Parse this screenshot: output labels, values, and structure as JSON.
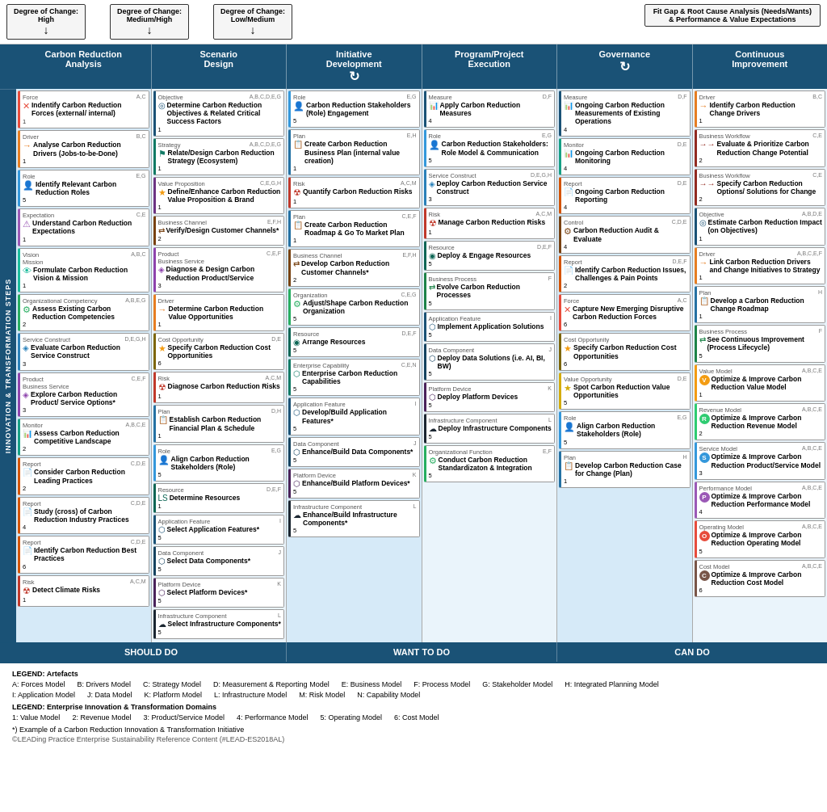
{
  "topArrows": [
    {
      "label": "Degree of Change:\nHigh"
    },
    {
      "label": "Degree of Change:\nMedium/High"
    },
    {
      "label": "Degree of Change:\nLow/Medium"
    }
  ],
  "topRight": {
    "label": "Fit Gap & Root Cause Analysis (Needs/Wants)\n& Performance & Value Expectations"
  },
  "colHeaders": [
    {
      "label": "Carbon Reduction\nAnalysis"
    },
    {
      "label": "Scenario\nDesign"
    },
    {
      "label": "Initiative\nDevelopment"
    },
    {
      "label": "Program/Project\nExecution"
    },
    {
      "label": "Governance"
    },
    {
      "label": "Continuous\nImprovement"
    }
  ],
  "sideLabel": "INNOVATION & TRANSFORMATION STEPS",
  "columns": {
    "col1": [
      {
        "type": "Force",
        "codes": "A,C",
        "title": "Indentify Carbon Reduction Forces (external/ internal)",
        "num": "1",
        "icon": "x"
      },
      {
        "type": "Driver",
        "codes": "B,C",
        "title": "Analyse Carbon Reduction Drivers (Jobs-to-be-Done)",
        "num": "1",
        "icon": "arrow"
      },
      {
        "type": "Role",
        "codes": "E,G",
        "title": "Identify Relevant Carbon Reduction Roles",
        "num": "5",
        "icon": "person"
      },
      {
        "type": "Expectation",
        "codes": "C,E",
        "title": "Understand Carbon Reduction Expectations",
        "num": "1",
        "icon": "exclaim"
      },
      {
        "type": "Vision\nMission",
        "codes": "A,B,C",
        "title": "Formulate Carbon Reduction Vision & Mission",
        "num": "1",
        "icon": "eye"
      },
      {
        "type": "Organizational Competency",
        "codes": "A,B,E,G",
        "title": "Assess Existing Carbon Reduction Competencies",
        "num": "2",
        "icon": "gear"
      },
      {
        "type": "Service Construct",
        "codes": "D,E,G,H",
        "title": "Evaluate Carbon Reduction Service Construct",
        "num": "3",
        "icon": "box"
      },
      {
        "type": "Product\nBusiness Service",
        "codes": "C,E,F",
        "title": "Explore Carbon Reduction Product/ Service Options*",
        "num": "3",
        "icon": "box"
      },
      {
        "type": "Monitor",
        "codes": "A,B,C,E",
        "title": "Assess Carbon Reduction Competitive Landscape",
        "num": "2",
        "icon": "chart"
      },
      {
        "type": "Report",
        "codes": "C,D,E",
        "title": "Consider Carbon Reduction Leading Practices",
        "num": "2",
        "icon": "doc"
      },
      {
        "type": "Report",
        "codes": "C,D,E",
        "title": "Study (cross) of Carbon Reduction Industry Practices",
        "num": "4",
        "icon": "doc"
      },
      {
        "type": "Report",
        "codes": "C,D,E",
        "title": "Identify Carbon Reduction Best Practices",
        "num": "6",
        "icon": "doc"
      },
      {
        "type": "Risk",
        "codes": "A,C,M",
        "title": "Detect Climate Risks",
        "num": "1",
        "icon": "lightning"
      }
    ],
    "col2": [
      {
        "type": "Objective",
        "codes": "A,B,C,D,E,G",
        "title": "Determine Carbon Reduction Objectives & Related Critical Success Factors",
        "num": "1",
        "icon": "target"
      },
      {
        "type": "Strategy",
        "codes": "A,B,C,D,E,G",
        "title": "Relate/Design Carbon Reduction Strategy (Ecosystem)",
        "num": "1",
        "icon": "flag"
      },
      {
        "type": "Value Proposition",
        "codes": "C,E,G,H",
        "title": "Define/Enhance Carbon Reduction Value Proposition & Brand",
        "num": "1",
        "icon": "star"
      },
      {
        "type": "Business Channel",
        "codes": "E,F,H",
        "title": "Verify/Design Customer Channels*",
        "num": "2",
        "icon": "flow"
      },
      {
        "type": "Product\nBusiness Service",
        "codes": "C,E,F",
        "title": "Diagnose & Design Carbon Reduction Product/Service",
        "num": "3",
        "icon": "box"
      },
      {
        "type": "Driver",
        "codes": "",
        "title": "Determine Carbon Reduction Value Opportunities",
        "num": "1",
        "icon": "arrow"
      },
      {
        "type": "Cost Opportunity",
        "codes": "D,E",
        "title": "Specify Carbon Reduction Cost Opportunities",
        "num": "6",
        "icon": "star"
      },
      {
        "type": "Risk",
        "codes": "A,C,M",
        "title": "Diagnose Carbon Reduction Risks",
        "num": "1",
        "icon": "lightning"
      },
      {
        "type": "Plan",
        "codes": "D,H",
        "title": "Establish Carbon Reduction Financial Plan & Schedule",
        "num": "1",
        "icon": "doc"
      },
      {
        "type": "Role",
        "codes": "E,G",
        "title": "Align Carbon Reduction Stakeholders (Role)",
        "num": "5",
        "icon": "person"
      },
      {
        "type": "Resource",
        "codes": "D,E,F",
        "title": "Determine Resources",
        "num": "1",
        "icon": "gear"
      },
      {
        "type": "Application Feature",
        "codes": "I",
        "title": "Select Application Features*",
        "num": "5",
        "icon": "box"
      },
      {
        "type": "Data Component",
        "codes": "J",
        "title": "Select Data Components*",
        "num": "5",
        "icon": "box"
      },
      {
        "type": "Platform Device",
        "codes": "K",
        "title": "Select Platform Devices*",
        "num": "5",
        "icon": "box"
      },
      {
        "type": "Infrastructure Component",
        "codes": "L",
        "title": "Select Infrastructure Components*",
        "num": "5",
        "icon": "cloud"
      }
    ],
    "col3": [
      {
        "type": "Role",
        "codes": "E,G",
        "title": "Carbon Reduction Stakeholders (Role) Engagement",
        "num": "5",
        "icon": "person"
      },
      {
        "type": "Plan",
        "codes": "E,H",
        "title": "Create Carbon Reduction Business Plan (internal value creation)",
        "num": "1",
        "icon": "doc"
      },
      {
        "type": "Risk",
        "codes": "A,C,M",
        "title": "Quantify Carbon Reduction Risks",
        "num": "1",
        "icon": "lightning"
      },
      {
        "type": "Plan",
        "codes": "C,E,F",
        "title": "Create Carbon Reduction Roadmap & Go To Market Plan",
        "num": "1",
        "icon": "doc"
      },
      {
        "type": "Business Channel",
        "codes": "E,F,H",
        "title": "Develop Carbon Reduction Customer Channels*",
        "num": "2",
        "icon": "flow"
      },
      {
        "type": "Organization",
        "codes": "C,E,G",
        "title": "Adjust/Shape Carbon Reduction Organization",
        "num": "5",
        "icon": "gear"
      },
      {
        "type": "Resource",
        "codes": "D,E,F",
        "title": "Arrange Resources",
        "num": "5",
        "icon": "gear"
      },
      {
        "type": "Enterprise Capability",
        "codes": "C,E,N",
        "title": "Enterprise Carbon Reduction Capabilities",
        "num": "5",
        "icon": "gear"
      },
      {
        "type": "Application Feature",
        "codes": "I",
        "title": "Develop/Build Application Features*",
        "num": "5",
        "icon": "box"
      },
      {
        "type": "Data Component",
        "codes": "J",
        "title": "Enhance/Build Data Components*",
        "num": "5",
        "icon": "box"
      },
      {
        "type": "Platform Device",
        "codes": "K",
        "title": "Enhance/Build Platform Devices*",
        "num": "5",
        "icon": "box"
      },
      {
        "type": "Infrastructure Component",
        "codes": "L",
        "title": "Enhance/Build Infrastructure Components*",
        "num": "5",
        "icon": "cloud"
      }
    ],
    "col4": [
      {
        "type": "Measure",
        "codes": "D,F",
        "title": "Apply Carbon Reduction Measures",
        "num": "4",
        "icon": "chart"
      },
      {
        "type": "Role",
        "codes": "E,G",
        "title": "Carbon Reduction Stakeholders: Role Model & Communication",
        "num": "5",
        "icon": "person"
      },
      {
        "type": "Service Construct",
        "codes": "D,E,G,H",
        "title": "Deploy Carbon Reduction Service Construct",
        "num": "3",
        "icon": "box"
      },
      {
        "type": "Risk",
        "codes": "A,C,M",
        "title": "Manage Carbon Reduction Risks",
        "num": "1",
        "icon": "lightning"
      },
      {
        "type": "Resource",
        "codes": "D,E,F",
        "title": "Deploy & Engage Resources",
        "num": "5",
        "icon": "gear"
      },
      {
        "type": "Business Process",
        "codes": "F",
        "title": "Evolve Carbon Reduction Processes",
        "num": "5",
        "icon": "flow"
      },
      {
        "type": "Application Feature",
        "codes": "I",
        "title": "Implement Application Solutions",
        "num": "5",
        "icon": "box"
      },
      {
        "type": "Data Component",
        "codes": "J",
        "title": "Deploy Data Solutions (i.e. AI, BI, BW)",
        "num": "5",
        "icon": "box"
      },
      {
        "type": "Platform Device",
        "codes": "K",
        "title": "Deploy Platform Devices",
        "num": "5",
        "icon": "box"
      },
      {
        "type": "Infrastructure Component",
        "codes": "L",
        "title": "Deploy Infrastructure Components",
        "num": "5",
        "icon": "cloud"
      },
      {
        "type": "Organizational Function",
        "codes": "E,F",
        "title": "Conduct Carbon Reduction Standardizaton & Integration",
        "num": "5",
        "icon": "gear"
      }
    ],
    "col5": [
      {
        "type": "Measure",
        "codes": "D,F",
        "title": "Ongoing Carbon Reduction Measurements of Existing Operations",
        "num": "4",
        "icon": "chart"
      },
      {
        "type": "Monitor",
        "codes": "D,E",
        "title": "Ongoing Carbon Reduction Monitoring",
        "num": "4",
        "icon": "chart"
      },
      {
        "type": "Report",
        "codes": "D,E",
        "title": "Ongoing Carbon Reduction Reporting",
        "num": "4",
        "icon": "doc"
      },
      {
        "type": "Control",
        "codes": "C,D,E",
        "title": "Carbon Reduction Audit & Evaluate",
        "num": "4",
        "icon": "gear"
      },
      {
        "type": "Report",
        "codes": "D,E,F",
        "title": "Identify Carbon Reduction Issues, Challenges & Pain Points",
        "num": "2",
        "icon": "doc"
      },
      {
        "type": "Force",
        "codes": "A,C",
        "title": "Capture New Emerging Disruptive Carbon Reduction Forces",
        "num": "6",
        "icon": "x"
      },
      {
        "type": "Cost Opportunity",
        "codes": "",
        "title": "Specify Carbon Reduction Cost Opportunities",
        "num": "6",
        "icon": "star"
      },
      {
        "type": "Value Opportunity",
        "codes": "D,E",
        "title": "Spot Carbon Reduction Value Opportunities",
        "num": "5",
        "icon": "star"
      },
      {
        "type": "Role",
        "codes": "E,G",
        "title": "Align Carbon Reduction Stakeholders (Role)",
        "num": "5",
        "icon": "person"
      },
      {
        "type": "Plan",
        "codes": "H",
        "title": "Develop Carbon Reduction Case for Change (Plan)",
        "num": "1",
        "icon": "doc"
      }
    ],
    "col6": [
      {
        "type": "Driver",
        "codes": "B,C",
        "title": "Identify Carbon Reduction Change Drivers",
        "num": "1",
        "icon": "arrow"
      },
      {
        "type": "Business Workflow",
        "codes": "C,E",
        "title": "Evaluate & Prioritize Carbon Reduction Change Potential",
        "num": "2",
        "icon": "flow"
      },
      {
        "type": "Business Workflow",
        "codes": "C,E",
        "title": "Specify Carbon Reduction Options/ Solutions for Change",
        "num": "2",
        "icon": "flow"
      },
      {
        "type": "Objective",
        "codes": "A,B,D,E",
        "title": "Estimate Carbon Reduction Impact (on Objectives)",
        "num": "1",
        "icon": "target"
      },
      {
        "type": "Driver",
        "codes": "A,B,C,E,F",
        "title": "Link Carbon Reduction Drivers and Change Initiatives to Strategy",
        "num": "1",
        "icon": "arrow"
      },
      {
        "type": "Plan",
        "codes": "H",
        "title": "Develop a Carbon Reduction Change Roadmap",
        "num": "1",
        "icon": "doc"
      },
      {
        "type": "Business Process",
        "codes": "F",
        "title": "See Continuous Improvement (Process Lifecycle)",
        "num": "5",
        "icon": "flow"
      },
      {
        "type": "Value Model",
        "codes": "A,B,C,E",
        "title": "Optimize & Improve Carbon Reduction Value Model",
        "num": "1",
        "icon": "V"
      },
      {
        "type": "Revenue Model",
        "codes": "A,B,C,E",
        "title": "Optimize & Improve Carbon Reduction Revenue Model",
        "num": "2",
        "icon": "R"
      },
      {
        "type": "Service Model",
        "codes": "A,B,C,E",
        "title": "Optimize & Improve Carbon Reduction Product/Service Model",
        "num": "3",
        "icon": "S"
      },
      {
        "type": "Performance Model",
        "codes": "A,B,C,E",
        "title": "Optimize & Improve Carbon Reduction Performance Model",
        "num": "4",
        "icon": "P"
      },
      {
        "type": "Operating Model",
        "codes": "A,B,C,E",
        "title": "Optimize & Improve Carbon Reduction Operating Model",
        "num": "5",
        "icon": "O"
      },
      {
        "type": "Cost Model",
        "codes": "A,B,C,E",
        "title": "Optimize & Improve Carbon Reduction Cost Model",
        "num": "6",
        "icon": "C"
      }
    ]
  },
  "bottomBar": [
    {
      "label": "SHOULD DO",
      "span": 2
    },
    {
      "label": "WANT TO DO",
      "span": 2
    },
    {
      "label": "CAN DO",
      "span": 2
    }
  ],
  "legend": {
    "title1": "LEGEND: Artefacts",
    "items1": [
      "A: Forces Model",
      "B: Drivers Model",
      "C: Strategy Model",
      "D: Measurement & Reporting Model",
      "E: Business Model",
      "F: Process Model",
      "G: Stakeholder Model",
      "H: Integrated Planning Model",
      "I: Application Model",
      "J: Data Model",
      "K: Platform Model",
      "L: Infrastructure Model",
      "M: Risk Model",
      "N: Capability Model"
    ],
    "title2": "LEGEND: Enterprise Innovation & Transformation Domains",
    "items2": [
      "1: Value Model",
      "2: Revenue Model",
      "3: Product/Service Model",
      "4: Performance Model",
      "5: Operating Model",
      "6: Cost Model"
    ],
    "note": "*) Example of a Carbon Reduction Innovation & Transformation Initiative",
    "credit": "©LEADing Practice Enterprise Sustainability Reference Content (#LEAD-ES2018AL)"
  }
}
